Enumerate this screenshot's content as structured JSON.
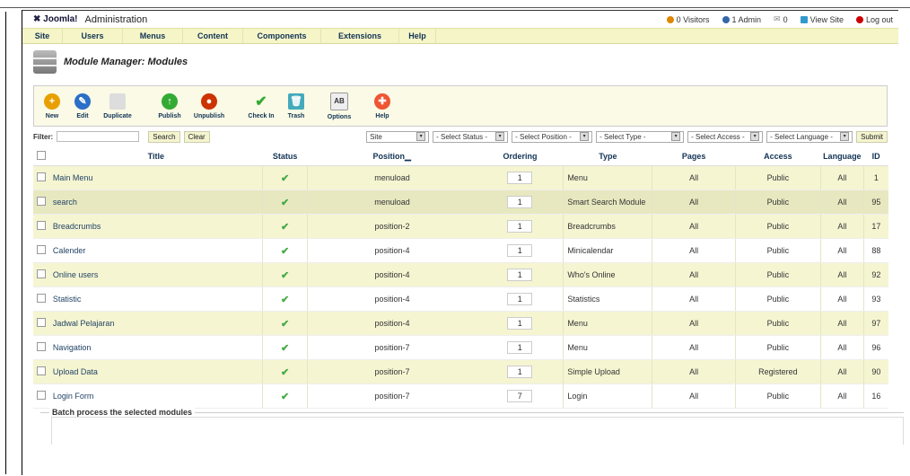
{
  "header": {
    "logo_text": "Joomla!",
    "admin_text": "Administration",
    "visitors": "0 Visitors",
    "admins": "1 Admin",
    "messages": "0",
    "view_site": "View Site",
    "logout": "Log out"
  },
  "menu": [
    "Site",
    "Users",
    "Menus",
    "Content",
    "Components",
    "Extensions",
    "Help"
  ],
  "page_title": "Module Manager: Modules",
  "toolbar": {
    "new": "New",
    "edit": "Edit",
    "duplicate": "Duplicate",
    "publish": "Publish",
    "unpublish": "Unpublish",
    "checkin": "Check In",
    "trash": "Trash",
    "options": "Options",
    "help": "Help"
  },
  "filter": {
    "label": "Filter:",
    "search": "Search",
    "clear": "Clear",
    "site": "Site",
    "status": "- Select Status -",
    "position": "- Select Position -",
    "type": "- Select Type -",
    "access": "- Select Access -",
    "language": "- Select Language -",
    "submit": "Submit"
  },
  "columns": {
    "title": "Title",
    "status": "Status",
    "position": "Position",
    "ordering": "Ordering",
    "type": "Type",
    "pages": "Pages",
    "access": "Access",
    "language": "Language",
    "id": "ID"
  },
  "rows": [
    {
      "title": "Main Menu",
      "position": "menuload",
      "ordering": "1",
      "type": "Menu",
      "pages": "All",
      "access": "Public",
      "language": "All",
      "id": "1"
    },
    {
      "title": "search",
      "position": "menuload",
      "ordering": "1",
      "type": "Smart Search Module",
      "pages": "All",
      "access": "Public",
      "language": "All",
      "id": "95"
    },
    {
      "title": "Breadcrumbs",
      "position": "position-2",
      "ordering": "1",
      "type": "Breadcrumbs",
      "pages": "All",
      "access": "Public",
      "language": "All",
      "id": "17"
    },
    {
      "title": "Calender",
      "position": "position-4",
      "ordering": "1",
      "type": "Minicalendar",
      "pages": "All",
      "access": "Public",
      "language": "All",
      "id": "88"
    },
    {
      "title": "Online users",
      "position": "position-4",
      "ordering": "1",
      "type": "Who's Online",
      "pages": "All",
      "access": "Public",
      "language": "All",
      "id": "92"
    },
    {
      "title": "Statistic",
      "position": "position-4",
      "ordering": "1",
      "type": "Statistics",
      "pages": "All",
      "access": "Public",
      "language": "All",
      "id": "93"
    },
    {
      "title": "Jadwal Pelajaran",
      "position": "position-4",
      "ordering": "1",
      "type": "Menu",
      "pages": "All",
      "access": "Public",
      "language": "All",
      "id": "97"
    },
    {
      "title": "Navigation",
      "position": "position-7",
      "ordering": "1",
      "type": "Menu",
      "pages": "All",
      "access": "Public",
      "language": "All",
      "id": "96"
    },
    {
      "title": "Upload Data",
      "position": "position-7",
      "ordering": "1",
      "type": "Simple Upload",
      "pages": "All",
      "access": "Registered",
      "language": "All",
      "id": "90"
    },
    {
      "title": "Login Form",
      "position": "position-7",
      "ordering": "7",
      "type": "Login",
      "pages": "All",
      "access": "Public",
      "language": "All",
      "id": "16"
    }
  ],
  "batch_legend": "Batch process the selected modules",
  "colors": {
    "menubar": "#f5f5c8",
    "row_odd": "#f5f5d2",
    "link": "#246",
    "published": "#4a4"
  }
}
